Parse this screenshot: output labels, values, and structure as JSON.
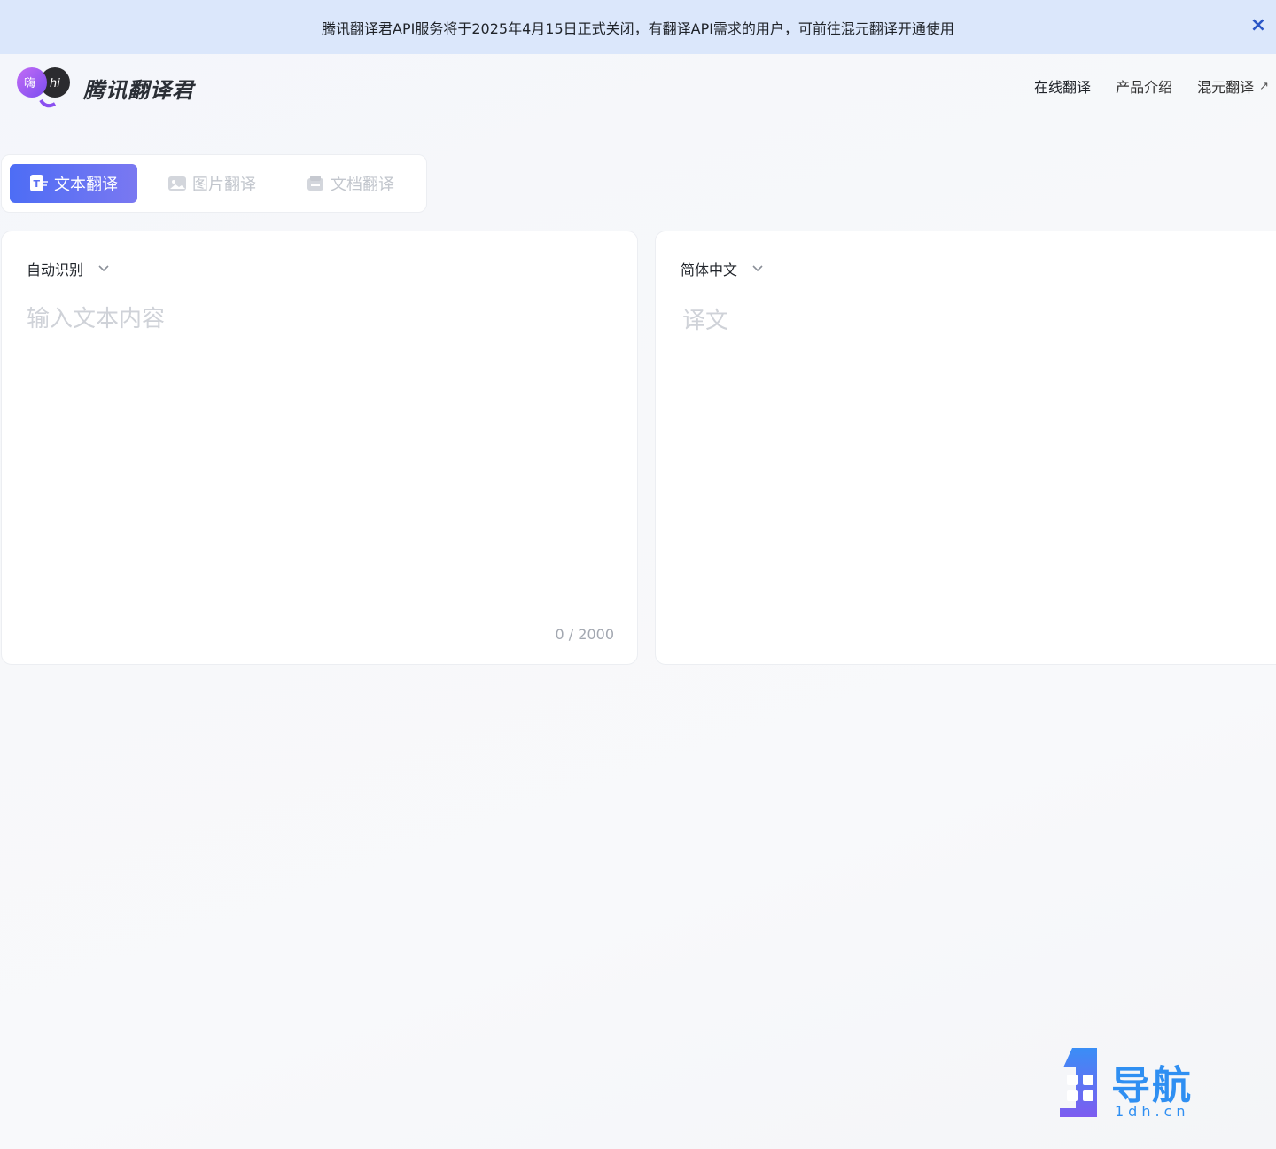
{
  "banner": {
    "message": "腾讯翻译君API服务将于2025年4月15日正式关闭，有翻译API需求的用户，可前往混元翻译开通使用",
    "close_icon": "×"
  },
  "header": {
    "logo_badge_left": "嗨",
    "logo_badge_right": "hi",
    "brand": "腾讯翻译君",
    "nav": [
      {
        "label": "在线翻译"
      },
      {
        "label": "产品介绍"
      },
      {
        "label": "混元翻译",
        "external_icon": "↗"
      }
    ]
  },
  "tabs": [
    {
      "label": "文本翻译",
      "active": true
    },
    {
      "label": "图片翻译",
      "active": false
    },
    {
      "label": "文档翻译",
      "active": false
    }
  ],
  "source": {
    "language": "自动识别",
    "placeholder": "输入文本内容",
    "counter": "0 / 2000"
  },
  "target": {
    "language": "简体中文",
    "placeholder": "译文"
  },
  "watermark": {
    "text": "导航",
    "sub": "1dh.cn"
  },
  "colors": {
    "banner_bg": "#dbe7fb",
    "tab_active_start": "#4d6df5",
    "tab_active_end": "#7a78f1",
    "close_icon": "#2a56c6",
    "watermark": "#2f8ff2"
  }
}
